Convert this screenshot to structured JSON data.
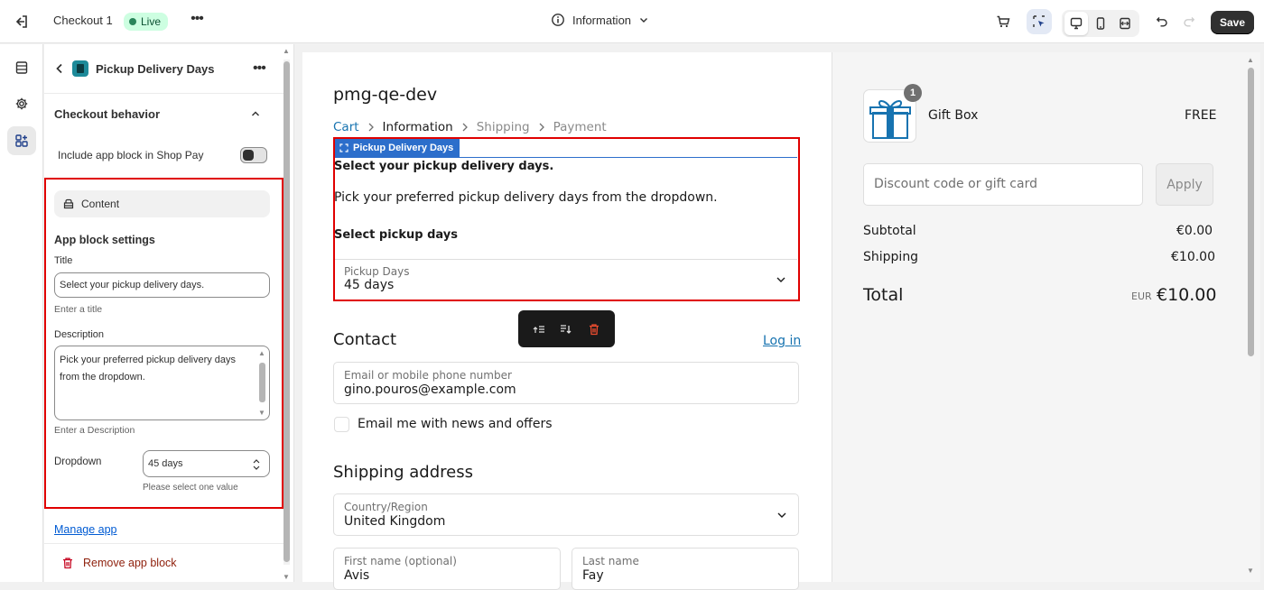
{
  "topbar": {
    "checkout_title": "Checkout 1",
    "live_badge": "Live",
    "page_selector": "Information",
    "save_label": "Save"
  },
  "panel": {
    "header_title": "Pickup Delivery Days",
    "behavior_title": "Checkout behavior",
    "shop_pay_label": "Include app block in Shop Pay",
    "shop_pay_enabled": false,
    "content_chip": "Content",
    "settings_title": "App block settings",
    "title_label": "Title",
    "title_value": "Select your pickup delivery days.",
    "title_hint": "Enter a title",
    "description_label": "Description",
    "description_value": "Pick your preferred pickup delivery days from the dropdown.",
    "description_hint": "Enter a Description",
    "dropdown_label": "Dropdown",
    "dropdown_value": "45 days",
    "dropdown_hint": "Please select one value",
    "manage_app": "Manage app",
    "remove_block": "Remove app block"
  },
  "checkout": {
    "store_name": "pmg-qe-dev",
    "breadcrumb": {
      "cart": "Cart",
      "information": "Information",
      "shipping": "Shipping",
      "payment": "Payment"
    },
    "block_tag": "Pickup Delivery Days",
    "block_title": "Select your pickup delivery days.",
    "block_description": "Pick your preferred pickup delivery days from the dropdown.",
    "select_heading": "Select pickup days",
    "pickup_label": "Pickup Days",
    "pickup_value": "45 days",
    "contact_heading": "Contact",
    "login_link": "Log in",
    "email_label": "Email or mobile phone number",
    "email_value": "gino.pouros@example.com",
    "news_label": "Email me with news and offers",
    "shipping_heading": "Shipping address",
    "country_label": "Country/Region",
    "country_value": "United Kingdom",
    "first_name_label": "First name (optional)",
    "first_name_value": "Avis",
    "last_name_label": "Last name",
    "last_name_value": "Fay"
  },
  "summary": {
    "item_qty": "1",
    "item_name": "Gift Box",
    "item_price": "FREE",
    "discount_placeholder": "Discount code or gift card",
    "apply_label": "Apply",
    "subtotal_label": "Subtotal",
    "subtotal_value": "€0.00",
    "shipping_label": "Shipping",
    "shipping_value": "€10.00",
    "total_label": "Total",
    "currency": "EUR",
    "total_value": "€10.00"
  },
  "colors": {
    "highlight": "#e00000",
    "accent_blue": "#1773b0",
    "tag_blue": "#2c6ecb"
  }
}
